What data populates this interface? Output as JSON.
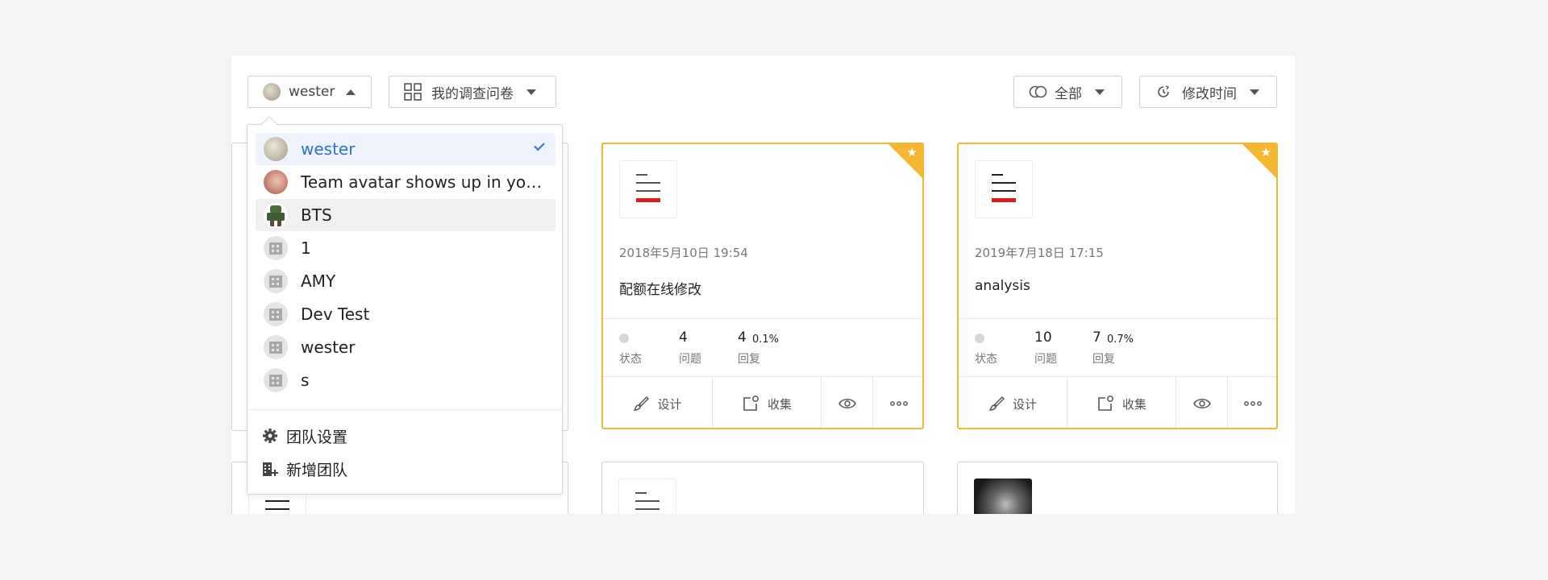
{
  "toolbar": {
    "team_name": "wester",
    "surveys_label": "我的调查问卷",
    "filter_label": "全部",
    "sort_label": "修改时间"
  },
  "cards": [
    {
      "date": "2018年5月10日 19:54",
      "title": "配额在线修改",
      "status_label": "状态",
      "questions": "4",
      "questions_label": "问题",
      "responses": "4",
      "responses_pct": "0.1%",
      "responses_label": "回复",
      "design_label": "设计",
      "collect_label": "收集"
    },
    {
      "date": "2019年7月18日 17:15",
      "title": "analysis",
      "status_label": "状态",
      "questions": "10",
      "questions_label": "问题",
      "responses": "7",
      "responses_pct": "0.7%",
      "responses_label": "回复",
      "design_label": "设计",
      "collect_label": "收集"
    }
  ],
  "dropdown": {
    "items": [
      {
        "label": "wester",
        "avatar": "photo-moon",
        "selected": true
      },
      {
        "label": "Team avatar shows up in your surveys",
        "avatar": "photo-portrait"
      },
      {
        "label": "BTS",
        "avatar": "photo-robot",
        "hovered": true
      },
      {
        "label": "1",
        "avatar": "building-icon"
      },
      {
        "label": "AMY",
        "avatar": "building-icon"
      },
      {
        "label": "Dev Test",
        "avatar": "building-icon"
      },
      {
        "label": "wester",
        "avatar": "building-icon"
      },
      {
        "label": "s",
        "avatar": "building-icon"
      }
    ],
    "team_settings": "团队设置",
    "new_team": "新增团队"
  },
  "colors": {
    "accent": "#2f6fd6",
    "star": "#f5b731",
    "red": "#d61f1f"
  }
}
